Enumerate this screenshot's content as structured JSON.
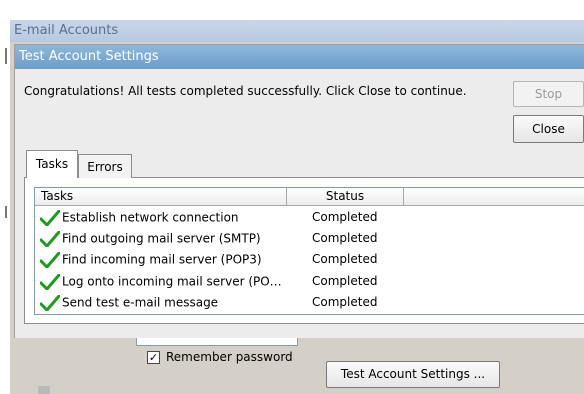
{
  "background_window": {
    "title": "E-mail Accounts"
  },
  "dialog": {
    "title": "Test Account Settings",
    "message": "Congratulations! All tests completed successfully. Click Close to continue.",
    "stop_label": "Stop",
    "close_label": "Close",
    "tabs": [
      {
        "label": "Tasks",
        "selected": true
      },
      {
        "label": "Errors",
        "selected": false
      }
    ],
    "columns": [
      "Tasks",
      "Status"
    ],
    "rows": [
      {
        "task": "Establish network connection",
        "status": "Completed",
        "icon": "checkmark-icon"
      },
      {
        "task": "Find outgoing mail server (SMTP)",
        "status": "Completed",
        "icon": "checkmark-icon"
      },
      {
        "task": "Find incoming mail server (POP3)",
        "status": "Completed",
        "icon": "checkmark-icon"
      },
      {
        "task": "Log onto incoming mail server (PO…",
        "status": "Completed",
        "icon": "checkmark-icon"
      },
      {
        "task": "Send test e-mail message",
        "status": "Completed",
        "icon": "checkmark-icon"
      }
    ],
    "colors": {
      "titlebar": "#7aa7d2",
      "check": "#1e9b1e"
    }
  },
  "account_form": {
    "remember_password_label": "Remember password",
    "remember_password_checked": true,
    "test_button_label": "Test Account Settings ..."
  }
}
